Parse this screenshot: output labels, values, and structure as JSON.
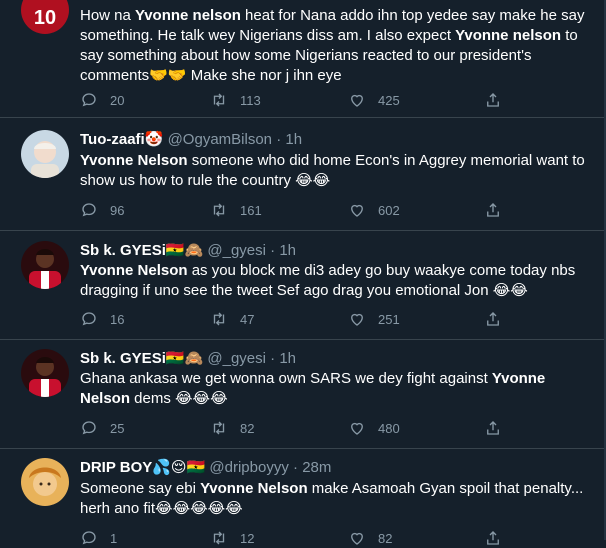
{
  "tweets": [
    {
      "name": "",
      "handle": "",
      "time": "",
      "text": [
        {
          "t": "How na "
        },
        {
          "b": "Yvonne nelson"
        },
        {
          "t": " heat for Nana addo ihn top yedee say make he say something. He talk wey Nigerians diss am. I also expect "
        },
        {
          "b": "Yvonne nelson"
        },
        {
          "t": " to say something about how some Nigerians reacted to our president's comments🤝🤝 Make she nor j ihn eye"
        }
      ],
      "avatar_text": "10",
      "replies": "20",
      "retweets": "113",
      "likes": "425"
    },
    {
      "name": "Tuo-zaafi🤡",
      "handle": "@OgyamBilson",
      "time": "1h",
      "text": [
        {
          "b": "Yvonne Nelson"
        },
        {
          "t": " someone who did home Econ's in Aggrey memorial want to show us how to rule the country 😂😂"
        }
      ],
      "replies": "96",
      "retweets": "161",
      "likes": "602"
    },
    {
      "name": "Sb k. GYESi🇬🇭🙈",
      "handle": "@_gyesi",
      "time": "1h",
      "text": [
        {
          "b": "Yvonne Nelson"
        },
        {
          "t": " as you block me di3 adey go buy waakye come today nbs dragging if uno see the tweet Sef ago drag you emotional Jon 😂😂"
        }
      ],
      "replies": "16",
      "retweets": "47",
      "likes": "251"
    },
    {
      "name": "Sb k. GYESi🇬🇭🙈",
      "handle": "@_gyesi",
      "time": "1h",
      "text": [
        {
          "t": "Ghana ankasa we get wonna own SARS we dey fight against "
        },
        {
          "b": "Yvonne Nelson"
        },
        {
          "t": " dems 😂😂😂"
        }
      ],
      "replies": "25",
      "retweets": "82",
      "likes": "480"
    },
    {
      "name": "DRIP BOY💦😌🇬🇭",
      "handle": "@dripboyyy",
      "time": "28m",
      "text": [
        {
          "t": "Someone say ebi "
        },
        {
          "b": "Yvonne Nelson"
        },
        {
          "t": " make Asamoah Gyan spoil that penalty... herh ano fit😂😂😂😂😂"
        }
      ],
      "replies": "1",
      "retweets": "12",
      "likes": "82"
    }
  ],
  "colors": {
    "background": "#15202b",
    "border": "#38444d",
    "muted": "#8899a6",
    "text": "#ffffff"
  },
  "icons": [
    "reply-icon",
    "retweet-icon",
    "like-icon",
    "share-icon"
  ]
}
